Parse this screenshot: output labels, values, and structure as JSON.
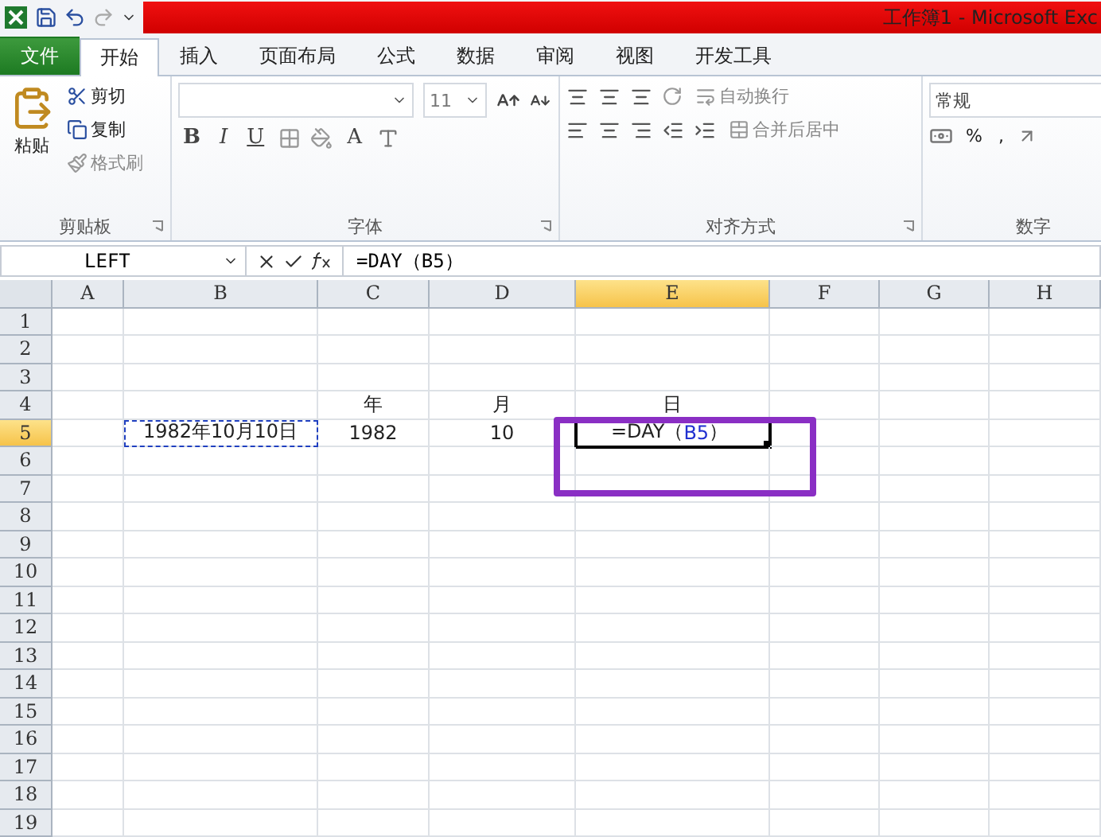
{
  "window": {
    "title": "工作簿1 - Microsoft Exc"
  },
  "tabs": [
    {
      "label": "文件",
      "kind": "file",
      "selected": false
    },
    {
      "label": "开始",
      "kind": "tab",
      "selected": true
    },
    {
      "label": "插入",
      "kind": "tab",
      "selected": false
    },
    {
      "label": "页面布局",
      "kind": "tab",
      "selected": false
    },
    {
      "label": "公式",
      "kind": "tab",
      "selected": false
    },
    {
      "label": "数据",
      "kind": "tab",
      "selected": false
    },
    {
      "label": "审阅",
      "kind": "tab",
      "selected": false
    },
    {
      "label": "视图",
      "kind": "tab",
      "selected": false
    },
    {
      "label": "开发工具",
      "kind": "tab",
      "selected": false
    }
  ],
  "ribbon": {
    "clipboard": {
      "label": "剪贴板",
      "paste": "粘贴",
      "cut": "剪切",
      "copy": "复制",
      "format_painter": "格式刷"
    },
    "font": {
      "label": "字体",
      "size": "11",
      "bold": "B",
      "italic": "I",
      "underline": "U",
      "font_color": "A"
    },
    "alignment": {
      "label": "对齐方式",
      "wrap_text": "自动换行",
      "merge_center": "合并后居中"
    },
    "number": {
      "label": "数字",
      "format": "常规",
      "percent": "%",
      "comma": ","
    }
  },
  "formula_bar": {
    "name_box": "LEFT",
    "formula": "=DAY（B5）"
  },
  "columns": [
    {
      "label": "A",
      "selected": false
    },
    {
      "label": "B",
      "selected": false
    },
    {
      "label": "C",
      "selected": false
    },
    {
      "label": "D",
      "selected": false
    },
    {
      "label": "E",
      "selected": true
    },
    {
      "label": "F",
      "selected": false
    },
    {
      "label": "G",
      "selected": false
    },
    {
      "label": "H",
      "selected": false
    }
  ],
  "rows": [
    {
      "label": "1",
      "selected": false
    },
    {
      "label": "2",
      "selected": false
    },
    {
      "label": "3",
      "selected": false
    },
    {
      "label": "4",
      "selected": false,
      "cells": [
        {},
        {},
        {
          "text": "年"
        },
        {
          "text": "月"
        },
        {
          "text": "日"
        },
        {},
        {},
        {}
      ]
    },
    {
      "label": "5",
      "selected": true,
      "cells": [
        {},
        {
          "text": "1982年10月10日",
          "copied": true
        },
        {
          "text": "1982"
        },
        {
          "text": "10"
        },
        {
          "kind": "formula",
          "active": true,
          "parts": [
            {
              "text": "=DAY（",
              "ref": false
            },
            {
              "text": "B5",
              "ref": true
            },
            {
              "text": "）",
              "ref": false
            }
          ]
        },
        {},
        {},
        {}
      ]
    },
    {
      "label": "6",
      "selected": false
    },
    {
      "label": "7",
      "selected": false
    },
    {
      "label": "8",
      "selected": false
    },
    {
      "label": "9",
      "selected": false
    },
    {
      "label": "10",
      "selected": false
    },
    {
      "label": "11",
      "selected": false
    },
    {
      "label": "12",
      "selected": false
    },
    {
      "label": "13",
      "selected": false
    },
    {
      "label": "14",
      "selected": false
    },
    {
      "label": "15",
      "selected": false
    },
    {
      "label": "16",
      "selected": false
    },
    {
      "label": "17",
      "selected": false
    },
    {
      "label": "18",
      "selected": false
    },
    {
      "label": "19",
      "selected": false
    }
  ]
}
